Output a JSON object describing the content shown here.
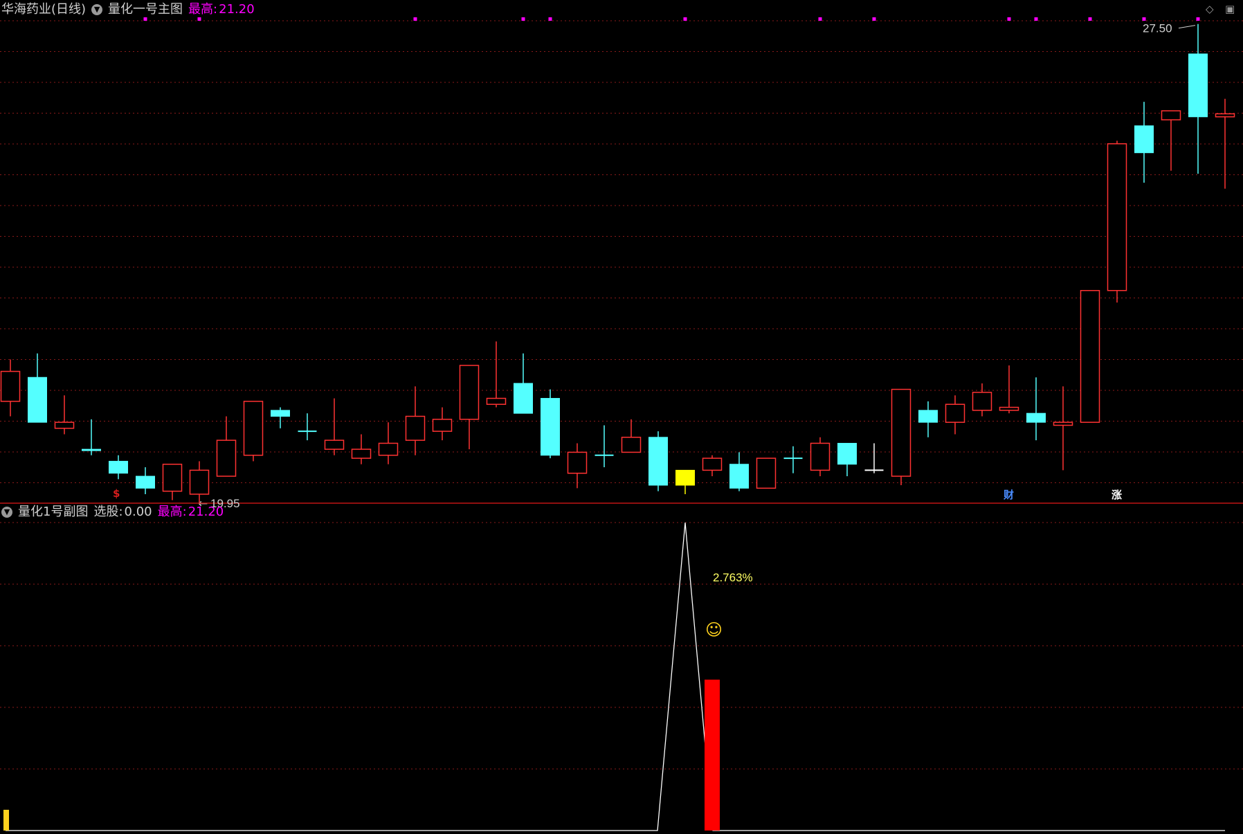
{
  "main_panel": {
    "stock_name": "华海药业(日线)",
    "indicator_name": "量化一号主图",
    "high_label": "最高:",
    "high_value": "21.20",
    "price_max_label": "27.50",
    "price_min_label": "19.95",
    "markers": [
      {
        "text": "$",
        "color": "#d81e1e",
        "bar": 4
      },
      {
        "text": "财",
        "color": "#4a8cff",
        "bar": 37
      },
      {
        "text": "涨",
        "color": "#ffffff",
        "bar": 41
      }
    ]
  },
  "sub_panel": {
    "indicator_name": "量化1号副图",
    "select_label": "选股:",
    "select_value": "0.00",
    "high_label": "最高:",
    "high_value": "21.20",
    "annotation_text": "2.763%",
    "smiley": "☺",
    "spike_bar": 25,
    "signal_bar": 26,
    "signal_level": 0.49
  },
  "colors": {
    "up": "#ff3232",
    "down": "#54ffff",
    "highlight": "#ffff00",
    "grid": "#8b1a1a",
    "divider": "#c01414",
    "magenta": "#ff00ff",
    "label_yellow": "#ffff64",
    "header_text": "#d0d0d0",
    "signal": "#ff0000",
    "spike_line": "#ffffff"
  },
  "chart_data": {
    "type": "candlestick",
    "price_range": [
      19.5,
      27.9
    ],
    "top_magenta_dots_bars": [
      5,
      7,
      15,
      19,
      20,
      25,
      30,
      32,
      37,
      38,
      40,
      42,
      44
    ],
    "candles": [
      {
        "o": 21.2,
        "h": 21.9,
        "l": 20.95,
        "c": 21.7,
        "kind": "up"
      },
      {
        "o": 21.6,
        "h": 22.0,
        "l": 20.85,
        "c": 20.85,
        "kind": "down"
      },
      {
        "o": 20.75,
        "h": 21.3,
        "l": 20.65,
        "c": 20.85,
        "kind": "up"
      },
      {
        "o": 20.4,
        "h": 20.9,
        "l": 20.3,
        "c": 20.4,
        "kind": "down"
      },
      {
        "o": 20.2,
        "h": 20.3,
        "l": 19.9,
        "c": 20.0,
        "kind": "down"
      },
      {
        "o": 19.95,
        "h": 20.1,
        "l": 19.65,
        "c": 19.75,
        "kind": "down"
      },
      {
        "o": 19.7,
        "h": 20.1,
        "l": 19.55,
        "c": 20.15,
        "kind": "up"
      },
      {
        "o": 19.65,
        "h": 20.2,
        "l": 19.5,
        "c": 20.05,
        "kind": "up"
      },
      {
        "o": 19.95,
        "h": 20.95,
        "l": 19.95,
        "c": 20.55,
        "kind": "up"
      },
      {
        "o": 20.3,
        "h": 21.2,
        "l": 20.2,
        "c": 21.2,
        "kind": "up"
      },
      {
        "o": 21.05,
        "h": 21.1,
        "l": 20.75,
        "c": 20.95,
        "kind": "down"
      },
      {
        "o": 20.7,
        "h": 21.0,
        "l": 20.55,
        "c": 20.7,
        "kind": "doji",
        "color": "#54ffff"
      },
      {
        "o": 20.4,
        "h": 21.25,
        "l": 20.3,
        "c": 20.55,
        "kind": "up"
      },
      {
        "o": 20.25,
        "h": 20.65,
        "l": 20.15,
        "c": 20.4,
        "kind": "up"
      },
      {
        "o": 20.3,
        "h": 20.85,
        "l": 20.15,
        "c": 20.5,
        "kind": "up"
      },
      {
        "o": 20.55,
        "h": 21.45,
        "l": 20.3,
        "c": 20.95,
        "kind": "up"
      },
      {
        "o": 20.7,
        "h": 21.1,
        "l": 20.55,
        "c": 20.9,
        "kind": "up"
      },
      {
        "o": 20.9,
        "h": 21.75,
        "l": 20.4,
        "c": 21.8,
        "kind": "up"
      },
      {
        "o": 21.15,
        "h": 22.2,
        "l": 21.1,
        "c": 21.25,
        "kind": "up"
      },
      {
        "o": 21.5,
        "h": 22.0,
        "l": 21.0,
        "c": 21.0,
        "kind": "down"
      },
      {
        "o": 21.25,
        "h": 21.4,
        "l": 20.25,
        "c": 20.3,
        "kind": "down"
      },
      {
        "o": 20.0,
        "h": 20.5,
        "l": 19.75,
        "c": 20.35,
        "kind": "up"
      },
      {
        "o": 20.3,
        "h": 20.8,
        "l": 20.1,
        "c": 20.3,
        "kind": "doji",
        "color": "#54ffff"
      },
      {
        "o": 20.35,
        "h": 20.9,
        "l": 20.35,
        "c": 20.6,
        "kind": "up"
      },
      {
        "o": 20.6,
        "h": 20.7,
        "l": 19.7,
        "c": 19.8,
        "kind": "down"
      },
      {
        "o": 19.8,
        "h": 20.05,
        "l": 19.65,
        "c": 20.05,
        "kind": "highlight"
      },
      {
        "o": 20.05,
        "h": 20.3,
        "l": 19.95,
        "c": 20.25,
        "kind": "up"
      },
      {
        "o": 19.75,
        "h": 20.35,
        "l": 19.7,
        "c": 20.15,
        "kind": "down"
      },
      {
        "o": 19.75,
        "h": 20.25,
        "l": 19.75,
        "c": 20.25,
        "kind": "up"
      },
      {
        "o": 20.25,
        "h": 20.45,
        "l": 20.0,
        "c": 20.25,
        "kind": "doji",
        "color": "#54ffff"
      },
      {
        "o": 20.05,
        "h": 20.6,
        "l": 19.95,
        "c": 20.5,
        "kind": "up"
      },
      {
        "o": 20.15,
        "h": 20.5,
        "l": 19.95,
        "c": 20.5,
        "kind": "down"
      },
      {
        "o": 20.05,
        "h": 20.5,
        "l": 20.0,
        "c": 20.05,
        "kind": "doji",
        "color": "#ffffff"
      },
      {
        "o": 19.95,
        "h": 21.4,
        "l": 19.8,
        "c": 21.4,
        "kind": "up"
      },
      {
        "o": 21.05,
        "h": 21.2,
        "l": 20.6,
        "c": 20.85,
        "kind": "down"
      },
      {
        "o": 20.85,
        "h": 21.3,
        "l": 20.65,
        "c": 21.15,
        "kind": "up"
      },
      {
        "o": 21.05,
        "h": 21.5,
        "l": 20.95,
        "c": 21.35,
        "kind": "up"
      },
      {
        "o": 21.05,
        "h": 21.8,
        "l": 21.0,
        "c": 21.1,
        "kind": "up"
      },
      {
        "o": 21.0,
        "h": 21.6,
        "l": 20.55,
        "c": 20.85,
        "kind": "down"
      },
      {
        "o": 20.8,
        "h": 21.45,
        "l": 20.05,
        "c": 20.85,
        "kind": "up"
      },
      {
        "o": 20.85,
        "h": 23.05,
        "l": 20.85,
        "c": 23.05,
        "kind": "up"
      },
      {
        "o": 23.05,
        "h": 25.55,
        "l": 22.85,
        "c": 25.5,
        "kind": "up"
      },
      {
        "o": 25.8,
        "h": 26.2,
        "l": 24.85,
        "c": 25.35,
        "kind": "down"
      },
      {
        "o": 25.9,
        "h": 26.05,
        "l": 25.05,
        "c": 26.05,
        "kind": "up"
      },
      {
        "o": 27.0,
        "h": 27.5,
        "l": 25.0,
        "c": 25.95,
        "kind": "down"
      },
      {
        "o": 25.95,
        "h": 26.25,
        "l": 24.75,
        "c": 26.0,
        "kind": "up"
      }
    ]
  }
}
